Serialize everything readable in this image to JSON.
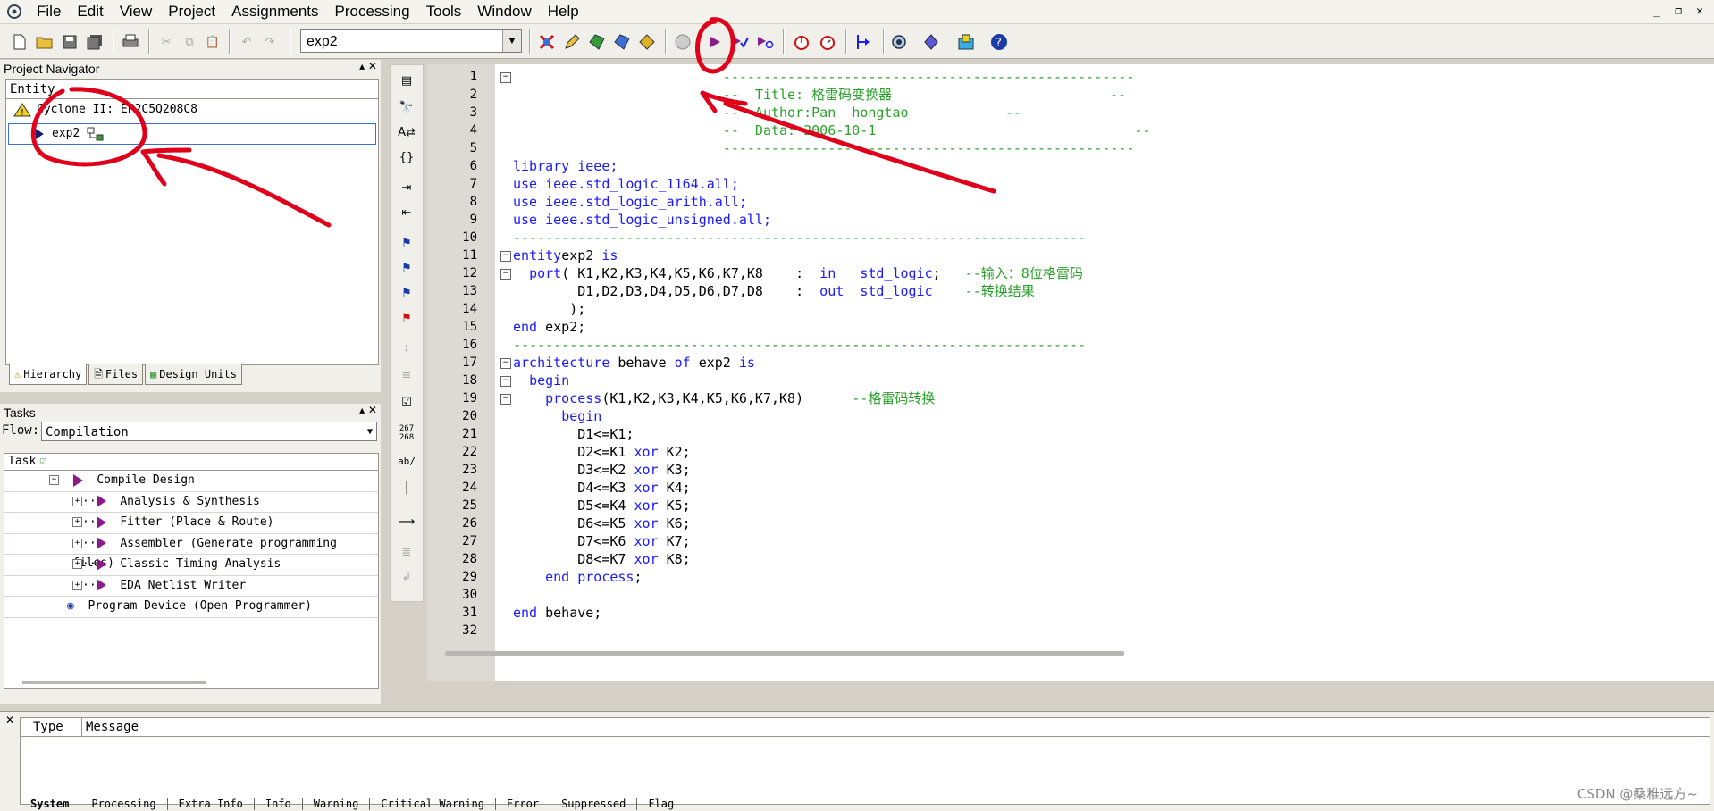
{
  "menu": [
    "File",
    "Edit",
    "View",
    "Project",
    "Assignments",
    "Processing",
    "Tools",
    "Window",
    "Help"
  ],
  "toolbar": {
    "entity_value": "exp2"
  },
  "project_navigator": {
    "title": "Project Navigator",
    "column": "Entity",
    "device": "Cyclone II: EP2C5Q208C8",
    "entity": "exp2",
    "tabs": [
      "Hierarchy",
      "Files",
      "Design Units"
    ]
  },
  "tasks": {
    "title": "Tasks",
    "flow_label": "Flow:",
    "flow_value": "Compilation",
    "column": "Task",
    "items": [
      {
        "label": "Compile Design"
      },
      {
        "label": "Analysis & Synthesis"
      },
      {
        "label": "Fitter (Place & Route)"
      },
      {
        "label": "Assembler (Generate programming files)"
      },
      {
        "label": "Classic Timing Analysis"
      },
      {
        "label": "EDA Netlist Writer"
      },
      {
        "label": "Program Device (Open Programmer)"
      }
    ]
  },
  "sidebar": {
    "counter_line1": "267",
    "counter_line2": "268",
    "ab_label": "ab/"
  },
  "messages": {
    "columns": [
      "Type",
      "Message"
    ],
    "tabs": [
      "System",
      "Processing",
      "Extra Info",
      "Info",
      "Warning",
      "Critical Warning",
      "Error",
      "Suppressed",
      "Flag"
    ]
  },
  "watermark": "CSDN @桑稚远方~",
  "colors": {
    "keyword": "#1a1aff",
    "comment": "#2aa22a",
    "annotation": "#e0001a"
  },
  "code": [
    {
      "n": "1",
      "t": [
        [
          "cm",
          "                          ---------------------------------------------------"
        ]
      ]
    },
    {
      "n": "2",
      "t": [
        [
          "cm",
          "                          --  Title: 格雷码变换器                           --"
        ]
      ]
    },
    {
      "n": "3",
      "t": [
        [
          "cm",
          "                          --  Author:Pan  hongtao            --"
        ]
      ]
    },
    {
      "n": "4",
      "t": [
        [
          "cm",
          "                          --  Data: 2006-10-1                                --"
        ]
      ]
    },
    {
      "n": "5",
      "t": [
        [
          "cm",
          "                          ---------------------------------------------------"
        ]
      ]
    },
    {
      "n": "6",
      "t": [
        [
          "kw",
          "library ieee;"
        ]
      ]
    },
    {
      "n": "7",
      "t": [
        [
          "kw",
          "use ieee.std_logic_1164.all;"
        ]
      ]
    },
    {
      "n": "8",
      "t": [
        [
          "kw",
          "use ieee.std_logic_arith.all;"
        ]
      ]
    },
    {
      "n": "9",
      "t": [
        [
          "kw",
          "use ieee.std_logic_unsigned.all;"
        ]
      ]
    },
    {
      "n": "10",
      "t": [
        [
          "cm",
          "-----------------------------------------------------------------------"
        ]
      ]
    },
    {
      "n": "11",
      "t": [
        [
          "kw",
          "entity"
        ],
        [
          "",
          "exp2 "
        ],
        [
          "kw",
          "is"
        ]
      ]
    },
    {
      "n": "12",
      "t": [
        [
          "",
          "  "
        ],
        [
          "kw",
          "port"
        ],
        [
          "",
          "( K1,K2,K3,K4,K5,K6,K7,K8    :  "
        ],
        [
          "kw",
          "in"
        ],
        [
          "",
          "   "
        ],
        [
          "kw",
          "std_logic"
        ],
        [
          "",
          ";   "
        ],
        [
          "cm",
          "--输入：8位格雷码"
        ]
      ]
    },
    {
      "n": "13",
      "t": [
        [
          "",
          "        D1,D2,D3,D4,D5,D6,D7,D8    :  "
        ],
        [
          "kw",
          "out"
        ],
        [
          "",
          "  "
        ],
        [
          "kw",
          "std_logic"
        ],
        [
          "",
          "    "
        ],
        [
          "cm",
          "--转换结果"
        ]
      ]
    },
    {
      "n": "14",
      "t": [
        [
          "",
          "       );"
        ]
      ]
    },
    {
      "n": "15",
      "t": [
        [
          "kw",
          "end"
        ],
        [
          "",
          " exp2;"
        ]
      ]
    },
    {
      "n": "16",
      "t": [
        [
          "cm",
          "-----------------------------------------------------------------------"
        ]
      ]
    },
    {
      "n": "17",
      "t": [
        [
          "kw",
          "architecture"
        ],
        [
          "",
          " behave "
        ],
        [
          "kw",
          "of"
        ],
        [
          "",
          " exp2 "
        ],
        [
          "kw",
          "is"
        ]
      ]
    },
    {
      "n": "18",
      "t": [
        [
          "",
          "  "
        ],
        [
          "kw",
          "begin"
        ]
      ]
    },
    {
      "n": "19",
      "t": [
        [
          "",
          "    "
        ],
        [
          "kw",
          "process"
        ],
        [
          "",
          "(K1,K2,K3,K4,K5,K6,K7,K8)      "
        ],
        [
          "cm",
          "--格雷码转换"
        ]
      ]
    },
    {
      "n": "20",
      "t": [
        [
          "",
          "      "
        ],
        [
          "kw",
          "begin"
        ]
      ]
    },
    {
      "n": "21",
      "t": [
        [
          "",
          "        D1<=K1;"
        ]
      ]
    },
    {
      "n": "22",
      "t": [
        [
          "",
          "        D2<=K1 "
        ],
        [
          "kw",
          "xor"
        ],
        [
          "",
          " K2;"
        ]
      ]
    },
    {
      "n": "23",
      "t": [
        [
          "",
          "        D3<=K2 "
        ],
        [
          "kw",
          "xor"
        ],
        [
          "",
          " K3;"
        ]
      ]
    },
    {
      "n": "24",
      "t": [
        [
          "",
          "        D4<=K3 "
        ],
        [
          "kw",
          "xor"
        ],
        [
          "",
          " K4;"
        ]
      ]
    },
    {
      "n": "25",
      "t": [
        [
          "",
          "        D5<=K4 "
        ],
        [
          "kw",
          "xor"
        ],
        [
          "",
          " K5;"
        ]
      ]
    },
    {
      "n": "26",
      "t": [
        [
          "",
          "        D6<=K5 "
        ],
        [
          "kw",
          "xor"
        ],
        [
          "",
          " K6;"
        ]
      ]
    },
    {
      "n": "27",
      "t": [
        [
          "",
          "        D7<=K6 "
        ],
        [
          "kw",
          "xor"
        ],
        [
          "",
          " K7;"
        ]
      ]
    },
    {
      "n": "28",
      "t": [
        [
          "",
          "        D8<=K7 "
        ],
        [
          "kw",
          "xor"
        ],
        [
          "",
          " K8;"
        ]
      ]
    },
    {
      "n": "29",
      "t": [
        [
          "",
          "    "
        ],
        [
          "kw",
          "end process"
        ],
        [
          "",
          ";"
        ]
      ]
    },
    {
      "n": "30",
      "t": [
        [
          "",
          ""
        ]
      ]
    },
    {
      "n": "31",
      "t": [
        [
          "kw",
          "end"
        ],
        [
          "",
          " behave;"
        ]
      ]
    },
    {
      "n": "32",
      "t": [
        [
          "",
          ""
        ]
      ]
    }
  ]
}
